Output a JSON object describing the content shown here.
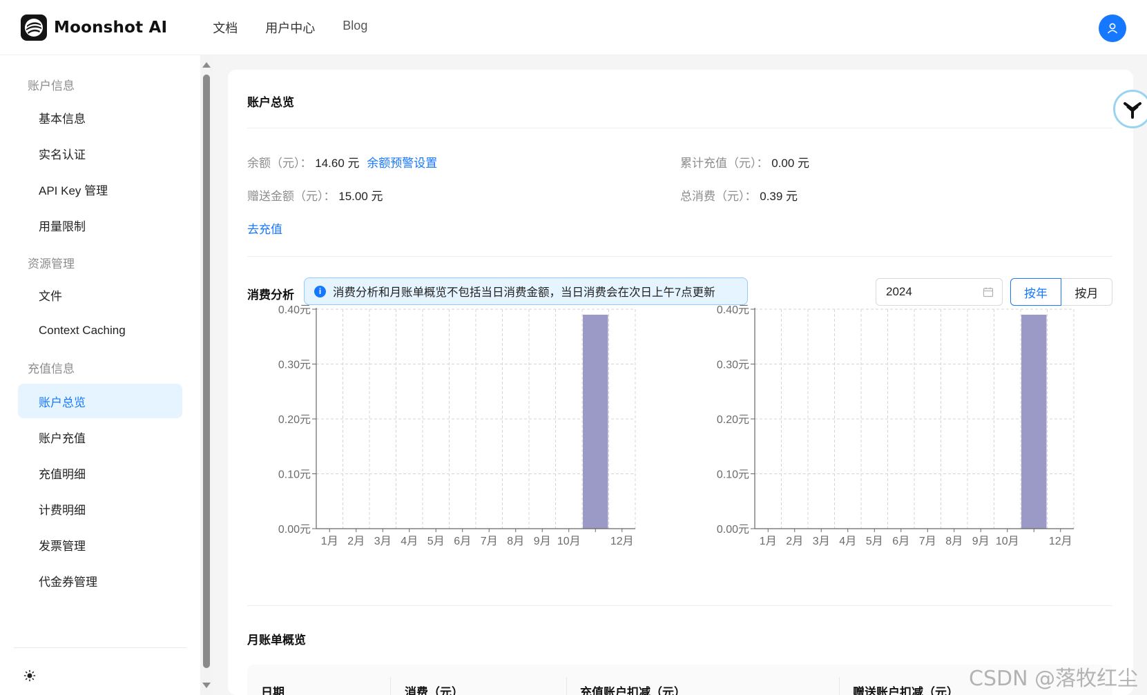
{
  "header": {
    "logo_text": "Moonshot AI",
    "nav": [
      "文档",
      "用户中心",
      "Blog"
    ]
  },
  "sidebar": {
    "groups": [
      "账户信息",
      "资源管理",
      "充值信息"
    ],
    "items": [
      "基本信息",
      "实名认证",
      "API Key 管理",
      "用量限制",
      "文件",
      "Context Caching",
      "账户总览",
      "账户充值",
      "充值明细",
      "计费明细",
      "发票管理",
      "代金券管理"
    ],
    "active": "账户总览"
  },
  "overview": {
    "title": "账户总览",
    "balance_label": "余额（元）：",
    "balance_value": "14.60 元",
    "balance_alert_link": "余额预警设置",
    "total_recharge_label": "累计充值（元）：",
    "total_recharge_value": "0.00 元",
    "gift_label": "赠送金额（元）：",
    "gift_value": "15.00 元",
    "total_spend_label": "总消费（元）：",
    "total_spend_value": "0.39 元",
    "recharge_link": "去充值"
  },
  "analysis": {
    "title": "消费分析",
    "notice": "消费分析和月账单概览不包括当日消费金额，当日消费会在次日上午7点更新",
    "year": "2024",
    "by_year": "按年",
    "by_month": "按月"
  },
  "chart_data": [
    {
      "type": "bar",
      "categories": [
        "1月",
        "2月",
        "3月",
        "4月",
        "5月",
        "6月",
        "7月",
        "8月",
        "9月",
        "10月",
        "11月",
        "12月"
      ],
      "x_tick_labels": [
        "1月",
        "2月",
        "3月",
        "4月",
        "5月",
        "6月",
        "7月",
        "8月",
        "9月",
        "10月",
        "",
        "12月"
      ],
      "values": [
        0,
        0,
        0,
        0,
        0,
        0,
        0,
        0,
        0,
        0,
        0.39,
        0
      ],
      "yticks": [
        "0.00元",
        "0.10元",
        "0.20元",
        "0.30元",
        "0.40元"
      ],
      "ylim": [
        0,
        0.4
      ],
      "grid": true,
      "bar_color": "#9b9ac6"
    },
    {
      "type": "bar",
      "categories": [
        "1月",
        "2月",
        "3月",
        "4月",
        "5月",
        "6月",
        "7月",
        "8月",
        "9月",
        "10月",
        "11月",
        "12月"
      ],
      "x_tick_labels": [
        "1月",
        "2月",
        "3月",
        "4月",
        "5月",
        "6月",
        "7月",
        "8月",
        "9月",
        "10月",
        "",
        "12月"
      ],
      "values": [
        0,
        0,
        0,
        0,
        0,
        0,
        0,
        0,
        0,
        0,
        0.39,
        0
      ],
      "yticks": [
        "0.00元",
        "0.10元",
        "0.20元",
        "0.30元",
        "0.40元"
      ],
      "ylim": [
        0,
        0.4
      ],
      "grid": true,
      "bar_color": "#9b9ac6"
    }
  ],
  "monthly": {
    "title": "月账单概览",
    "columns": [
      "日期",
      "消费（元）",
      "充值账户扣减（元）",
      "赠送账户扣减（元）"
    ]
  },
  "watermark": "CSDN @落牧红尘"
}
